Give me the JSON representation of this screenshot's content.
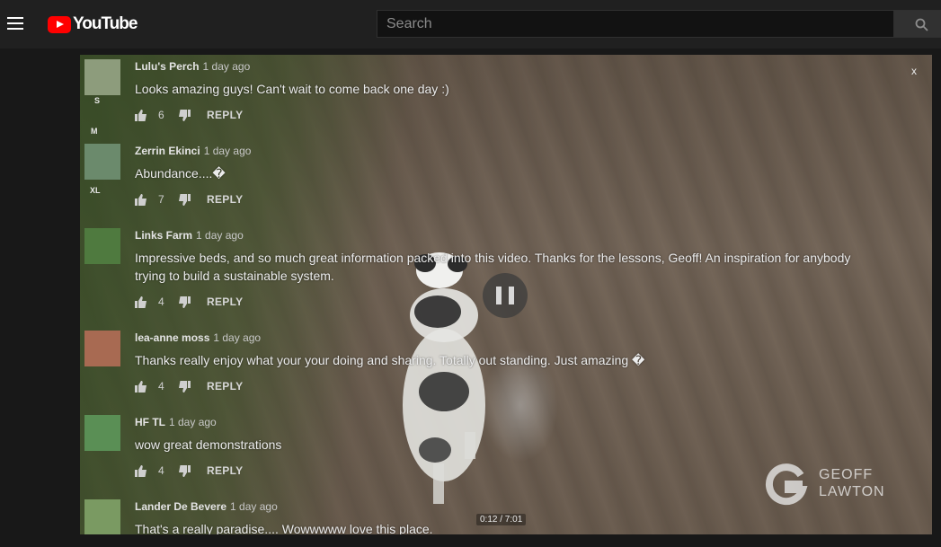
{
  "header": {
    "logo_text": "YouTube",
    "search_placeholder": "Search"
  },
  "player": {
    "close_label": "x",
    "timecode": "0:12 / 7:01",
    "watermark": {
      "line1": "GEOFF",
      "line2": "LAWTON"
    }
  },
  "side_labels": [
    "S",
    "M",
    "XL"
  ],
  "comments": [
    {
      "author": "Lulu's Perch",
      "time": "1 day ago",
      "text": "Looks amazing guys! Can't wait to come back one day :)",
      "likes": "6",
      "reply": "REPLY"
    },
    {
      "author": "Zerrin Ekinci",
      "time": "1 day ago",
      "text": "Abundance....�",
      "likes": "7",
      "reply": "REPLY"
    },
    {
      "author": "Links Farm",
      "time": "1 day ago",
      "text": "Impressive beds, and so much great information packed into this video. Thanks for the lessons, Geoff! An inspiration for anybody trying to build a sustainable system.",
      "likes": "4",
      "reply": "REPLY"
    },
    {
      "author": "lea-anne moss",
      "time": "1 day ago",
      "text": "Thanks really enjoy what your your doing and sharing. Totally out standing. Just amazing �",
      "likes": "4",
      "reply": "REPLY"
    },
    {
      "author": "HF TL",
      "time": "1 day ago",
      "text": "wow great demonstrations",
      "likes": "4",
      "reply": "REPLY"
    },
    {
      "author": "Lander De Bevere",
      "time": "1 day ago",
      "text": "That's a really paradise.... Wowwwww love this place.",
      "likes": "",
      "reply": ""
    }
  ]
}
